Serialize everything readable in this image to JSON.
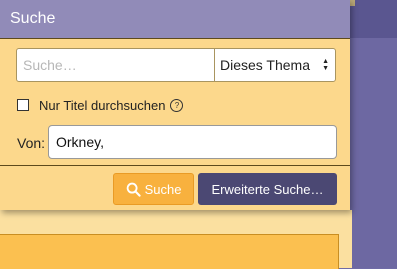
{
  "popup": {
    "title": "Suche",
    "search": {
      "placeholder": "Suche…",
      "value": ""
    },
    "scope_select": {
      "selected": "Dieses Thema"
    },
    "title_only": {
      "label": "Nur Titel durchsuchen",
      "checked": false,
      "help_icon": "question-circle-icon"
    },
    "from": {
      "label": "Von:",
      "value": "Orkney,"
    },
    "buttons": {
      "search_label": "Suche",
      "search_icon": "search-icon",
      "advanced_label": "Erweiterte Suche…"
    }
  },
  "colors": {
    "header": "#918bb8",
    "body": "#fcd88c",
    "primary_button": "#f8b13e",
    "secondary_button": "#4b4873"
  }
}
